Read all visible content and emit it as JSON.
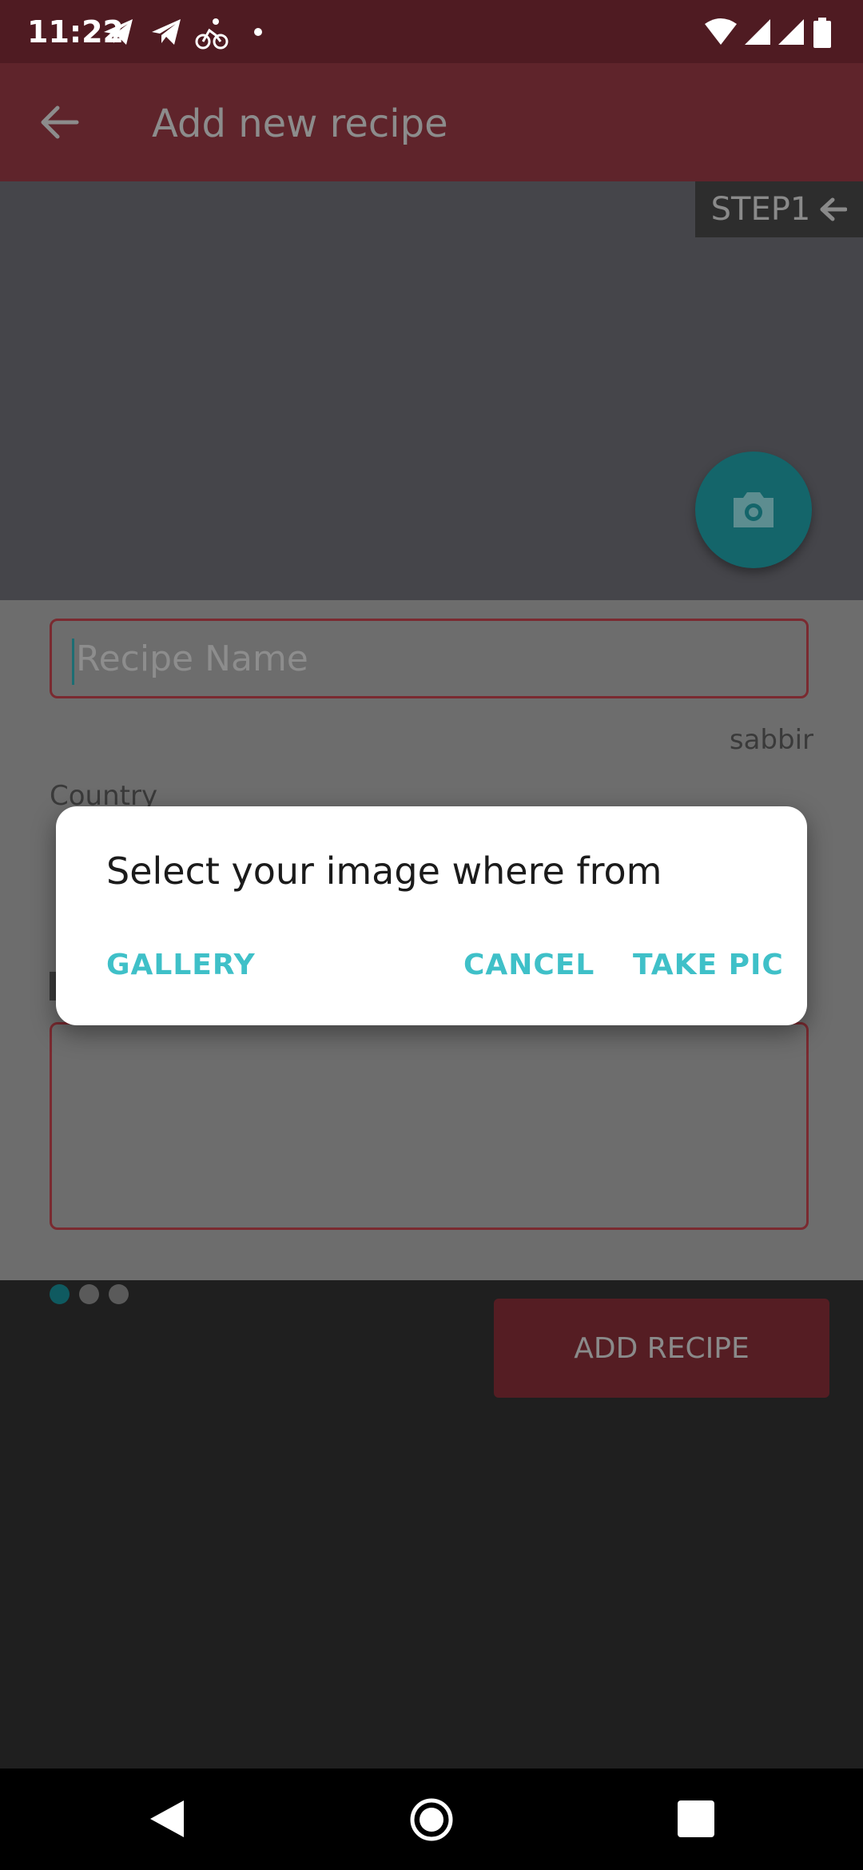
{
  "status_bar": {
    "time": "11:22",
    "left_icons": [
      "telegram-icon",
      "telegram-icon",
      "cycling-icon",
      "dot-icon"
    ],
    "right_icons": [
      "wifi-icon",
      "signal-icon",
      "signal-icon",
      "battery-icon"
    ]
  },
  "app_bar": {
    "title": "Add new recipe",
    "back_icon": "arrow-back-icon"
  },
  "image_area": {
    "step_label": "STEP1",
    "step_icon": "arrow-left-icon",
    "camera_icon": "camera-icon"
  },
  "form": {
    "recipe_name_placeholder": "Recipe Name",
    "author": "sabbir",
    "country_label": "Country"
  },
  "page_indicator": {
    "count": 3,
    "active_index": 0
  },
  "add_recipe_label": "ADD RECIPE",
  "dialog": {
    "title": "Select your image where from",
    "gallery_label": "GALLERY",
    "cancel_label": "CANCEL",
    "take_pic_label": "TAKE PIC"
  },
  "colors": {
    "accent": "#3fc0c8",
    "primary_dimmed": "#5f242b",
    "status_bar": "#4f1b22"
  }
}
